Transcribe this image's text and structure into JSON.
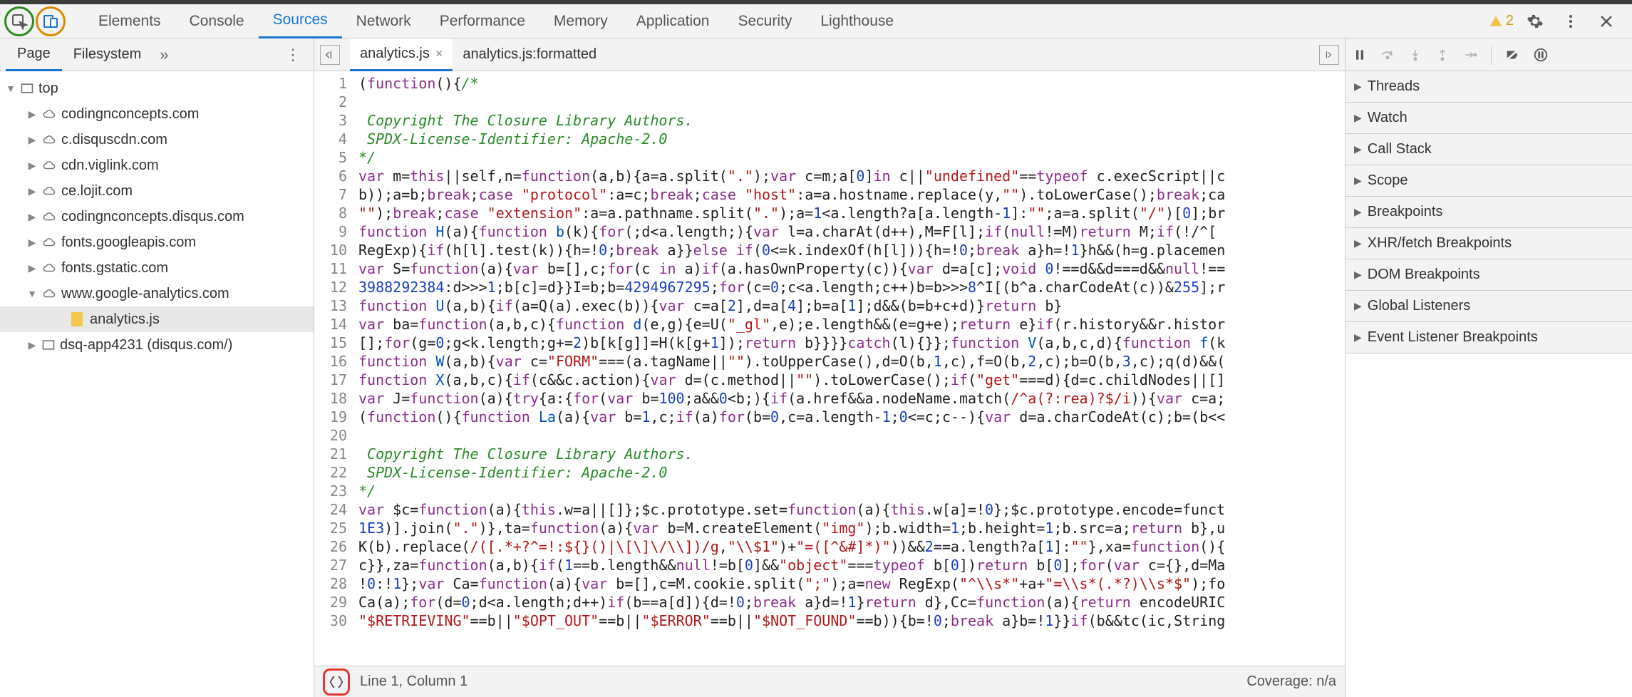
{
  "toolbar": {
    "tabs": [
      "Elements",
      "Console",
      "Sources",
      "Network",
      "Performance",
      "Memory",
      "Application",
      "Security",
      "Lighthouse"
    ],
    "active_tab": "Sources",
    "warning_count": "2"
  },
  "left": {
    "tabs": [
      "Page",
      "Filesystem"
    ],
    "active": "Page",
    "tree": {
      "top": "top",
      "domains": [
        "codingnconcepts.com",
        "c.disquscdn.com",
        "cdn.viglink.com",
        "ce.lojit.com",
        "codingnconcepts.disqus.com",
        "fonts.googleapis.com",
        "fonts.gstatic.com"
      ],
      "expanded_domain": "www.google-analytics.com",
      "file": "analytics.js",
      "iframe": "dsq-app4231 (disqus.com/)"
    }
  },
  "center": {
    "tabs": [
      "analytics.js",
      "analytics.js:formatted"
    ],
    "active": "analytics.js",
    "status_left": "Line 1, Column 1",
    "status_right": "Coverage: n/a"
  },
  "code_lines": {
    "count": 30
  },
  "right": {
    "sections": [
      "Threads",
      "Watch",
      "Call Stack",
      "Scope",
      "Breakpoints",
      "XHR/fetch Breakpoints",
      "DOM Breakpoints",
      "Global Listeners",
      "Event Listener Breakpoints"
    ]
  }
}
